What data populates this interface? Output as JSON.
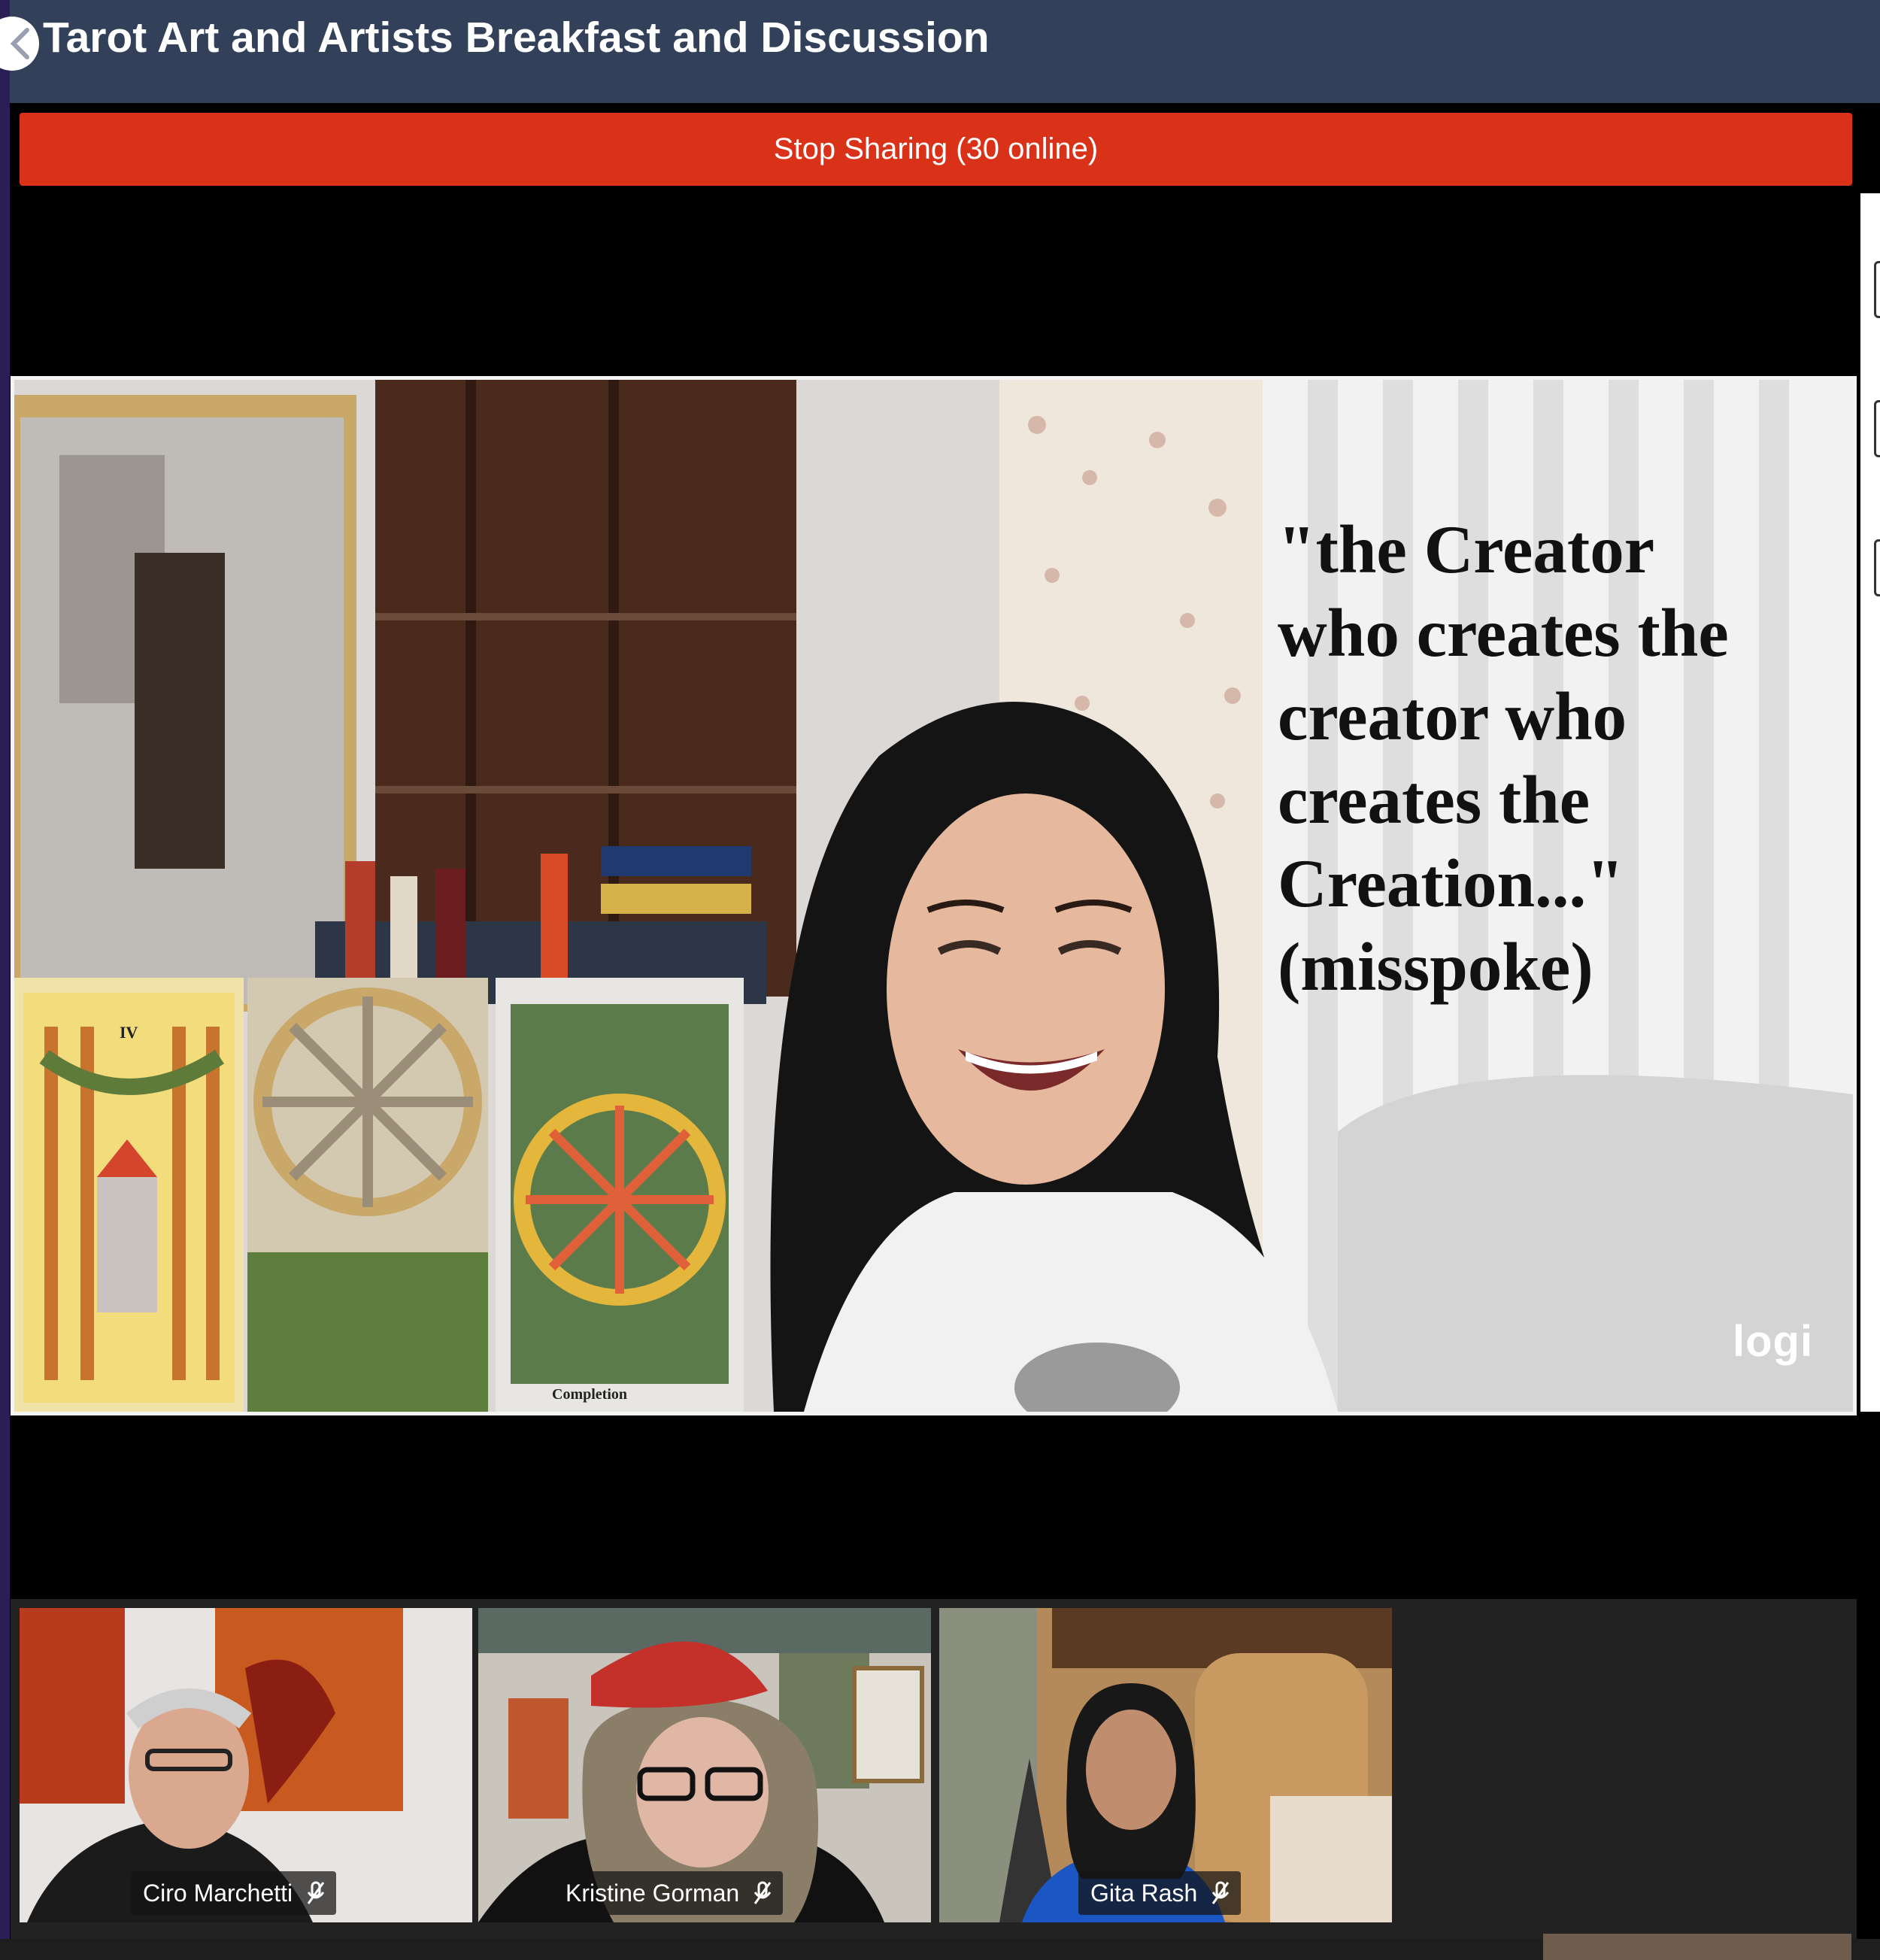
{
  "header": {
    "title": "Tarot Art and Artists Breakfast and Discussion"
  },
  "stop_sharing": {
    "label": "Stop Sharing (30 online)"
  },
  "main_video": {
    "quote": "\"the Creator\nwho creates the\ncreator who\ncreates the\nCreation...\"\n(misspoke)",
    "watermark": "logi",
    "card_numeral": "IV",
    "card_caption": "Completion"
  },
  "participants": [
    {
      "name": "Ciro Marchetti"
    },
    {
      "name": "Kristine Gorman"
    },
    {
      "name": "Gita Rash"
    }
  ],
  "colors": {
    "header_bg": "#33405a",
    "stop_bar": "#d93219",
    "strip_bg": "#222222"
  }
}
